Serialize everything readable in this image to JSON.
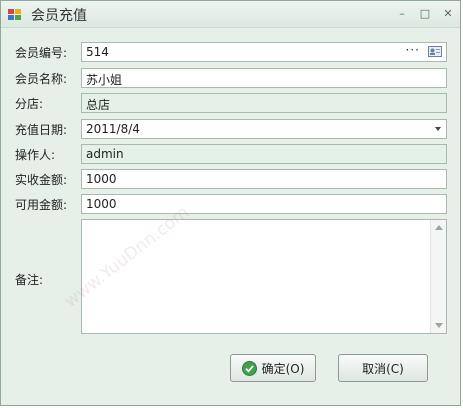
{
  "window": {
    "title": "会员充值",
    "controls": {
      "minimize": "–",
      "maximize": "□",
      "close": "✕"
    }
  },
  "form": {
    "member_no": {
      "label": "会员编号:",
      "value": "514",
      "browse": "···"
    },
    "member_name": {
      "label": "会员名称:",
      "value": "苏小姐"
    },
    "branch": {
      "label": "分店:",
      "value": "总店"
    },
    "date": {
      "label": "充值日期:",
      "value": "2011/8/4"
    },
    "operator": {
      "label": "操作人:",
      "value": "admin"
    },
    "received": {
      "label": "实收金额:",
      "value": "1000"
    },
    "available": {
      "label": "可用金额:",
      "value": "1000"
    },
    "notes": {
      "label": "备注:",
      "value": ""
    }
  },
  "buttons": {
    "ok": "确定(O)",
    "cancel": "取消(C)"
  },
  "watermark": "www.YuuDnn.com",
  "icons": {
    "app": "app-icon",
    "card": "id-card-icon",
    "ok": "check-circle-icon",
    "dropdown": "chevron-down-icon"
  }
}
